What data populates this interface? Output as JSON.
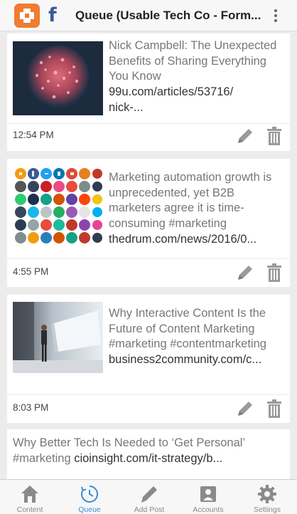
{
  "header": {
    "title": "Queue (Usable Tech Co - Form...",
    "logo_icon": "app-logo-icon",
    "facebook_icon": "facebook-icon",
    "menu_icon": "more-vertical-icon"
  },
  "posts": [
    {
      "text": "Nick Campbell: The Unexpected Benefits of Sharing Everything You Know",
      "link": "99u.com/articles/53716/",
      "link_more": "nick-...",
      "time": "12:54 PM"
    },
    {
      "text": "Marketing automation growth is unprecedented, yet B2B marketers agree it is time-consuming #marketing",
      "link": "thedrum.com/news/2016/0...",
      "time": "4:55 PM"
    },
    {
      "text": "Why Interactive Content Is the Future of Content Marketing #marketing #contentmarketing",
      "link": "business2community.com/c...",
      "time": "8:03 PM"
    },
    {
      "text_line1": "Why Better Tech Is Needed to ‘Get Personal’",
      "text_line2": "#marketing",
      "link": "cioinsight.com/it-strategy/b..."
    }
  ],
  "tabs": [
    {
      "label": "Content",
      "icon": "home-icon"
    },
    {
      "label": "Queue",
      "icon": "clock-icon",
      "active": true
    },
    {
      "label": "Add Post",
      "icon": "pencil-icon"
    },
    {
      "label": "Accounts",
      "icon": "accounts-icon"
    },
    {
      "label": "Settings",
      "icon": "gear-icon"
    }
  ],
  "colors": {
    "accent": "#3a8fd8",
    "brand_orange": "#f07b33",
    "facebook": "#3b5998",
    "background": "#ececec"
  }
}
